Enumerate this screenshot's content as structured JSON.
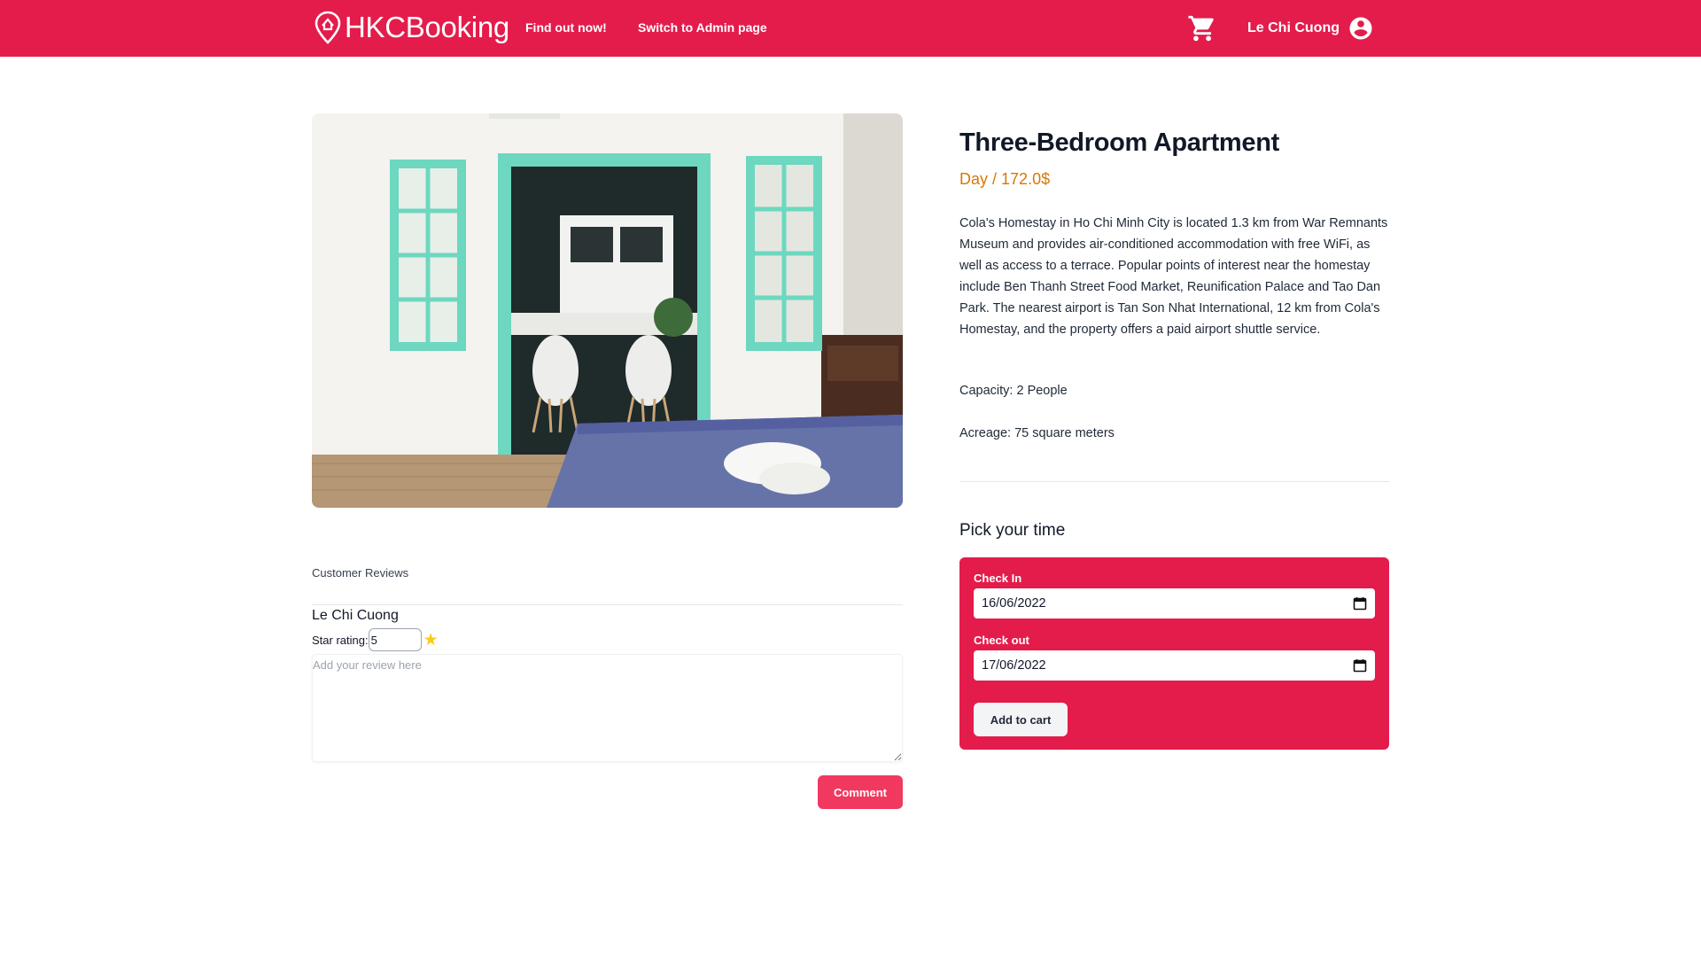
{
  "navbar": {
    "brand": "HKCBooking",
    "brand_icon": "map-pin-icon",
    "links": [
      "Find out now!",
      "Switch to Admin page"
    ],
    "cart_icon": "shopping-cart-icon",
    "user_name": "Le Chi Cuong",
    "user_icon": "account-circle-icon",
    "accent_color": "#e31c4b"
  },
  "room": {
    "title": "Three-Bedroom Apartment",
    "price_period": "Day",
    "price_separator": " / ",
    "price_value": "172.0$",
    "description": "Cola's Homestay in Ho Chi Minh City is located 1.3 km from War Remnants Museum and provides air-conditioned accommodation with free WiFi, as well as access to a terrace. Popular points of interest near the homestay include Ben Thanh Street Food Market, Reunification Palace and Tao Dan Park. The nearest airport is Tan Son Nhat International, 12 km from Cola's Homestay, and the property offers a paid airport shuttle service.",
    "capacity": "Capacity: 2 People",
    "acreage": "Acreage: 75 square meters"
  },
  "booking": {
    "title": "Pick your time",
    "check_in_label": "Check In",
    "check_in_value": "16/06/2022",
    "check_out_label": "Check out",
    "check_out_value": "17/06/2022",
    "add_to_cart": "Add to cart"
  },
  "reviews": {
    "title": "Customer Reviews",
    "reviewer": "Le Chi Cuong",
    "star_label": "Star rating:",
    "star_value": "5",
    "placeholder": "Add your review here",
    "comment_button": "Comment"
  }
}
